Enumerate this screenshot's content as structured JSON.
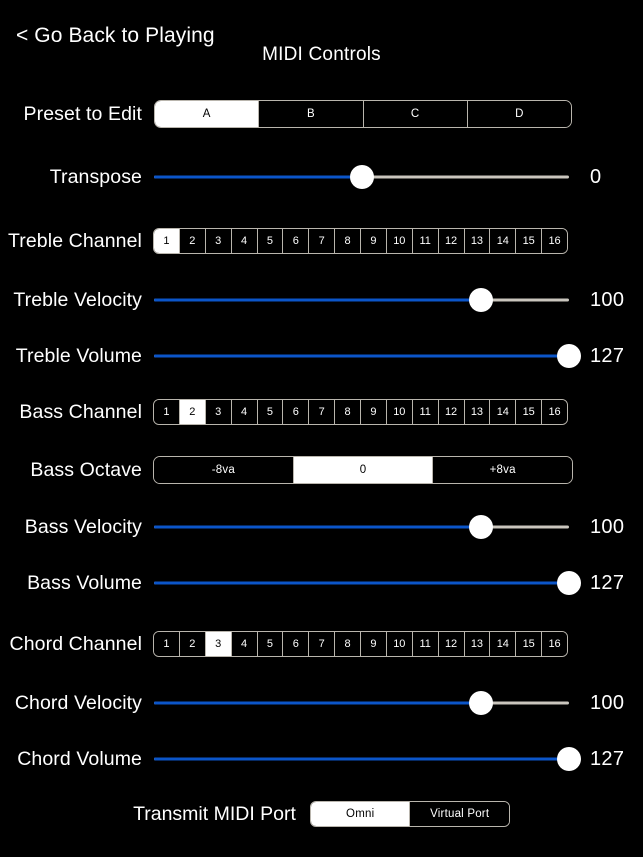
{
  "header": {
    "back_label": "< Go Back to Playing",
    "title": "MIDI Controls"
  },
  "colors": {
    "background": "#000000",
    "text": "#ffffff",
    "slider_fill": "#0b55c8",
    "slider_track": "#c9c5bd",
    "selected_bg": "#ffffff",
    "selected_text": "#000000",
    "border": "#b9b5ad"
  },
  "rows": {
    "preset": {
      "label": "Preset to Edit",
      "options": [
        "A",
        "B",
        "C",
        "D"
      ],
      "selected": "A"
    },
    "transpose": {
      "label": "Transpose",
      "value": "0",
      "percent": 50
    },
    "treble_channel": {
      "label": "Treble Channel",
      "options": [
        "1",
        "2",
        "3",
        "4",
        "5",
        "6",
        "7",
        "8",
        "9",
        "10",
        "11",
        "12",
        "13",
        "14",
        "15",
        "16"
      ],
      "selected": "1"
    },
    "treble_velocity": {
      "label": "Treble Velocity",
      "value": "100",
      "percent": 78.7
    },
    "treble_volume": {
      "label": "Treble Volume",
      "value": "127",
      "percent": 100
    },
    "bass_channel": {
      "label": "Bass Channel",
      "options": [
        "1",
        "2",
        "3",
        "4",
        "5",
        "6",
        "7",
        "8",
        "9",
        "10",
        "11",
        "12",
        "13",
        "14",
        "15",
        "16"
      ],
      "selected": "2"
    },
    "bass_octave": {
      "label": "Bass Octave",
      "options": [
        "-8va",
        "0",
        "+8va"
      ],
      "selected": "0"
    },
    "bass_velocity": {
      "label": "Bass Velocity",
      "value": "100",
      "percent": 78.7
    },
    "bass_volume": {
      "label": "Bass Volume",
      "value": "127",
      "percent": 100
    },
    "chord_channel": {
      "label": "Chord Channel",
      "options": [
        "1",
        "2",
        "3",
        "4",
        "5",
        "6",
        "7",
        "8",
        "9",
        "10",
        "11",
        "12",
        "13",
        "14",
        "15",
        "16"
      ],
      "selected": "3"
    },
    "chord_velocity": {
      "label": "Chord Velocity",
      "value": "100",
      "percent": 78.7
    },
    "chord_volume": {
      "label": "Chord Volume",
      "value": "127",
      "percent": 100
    },
    "transmit_port": {
      "label": "Transmit MIDI Port",
      "options": [
        "Omni",
        "Virtual Port"
      ],
      "selected": "Omni"
    }
  }
}
